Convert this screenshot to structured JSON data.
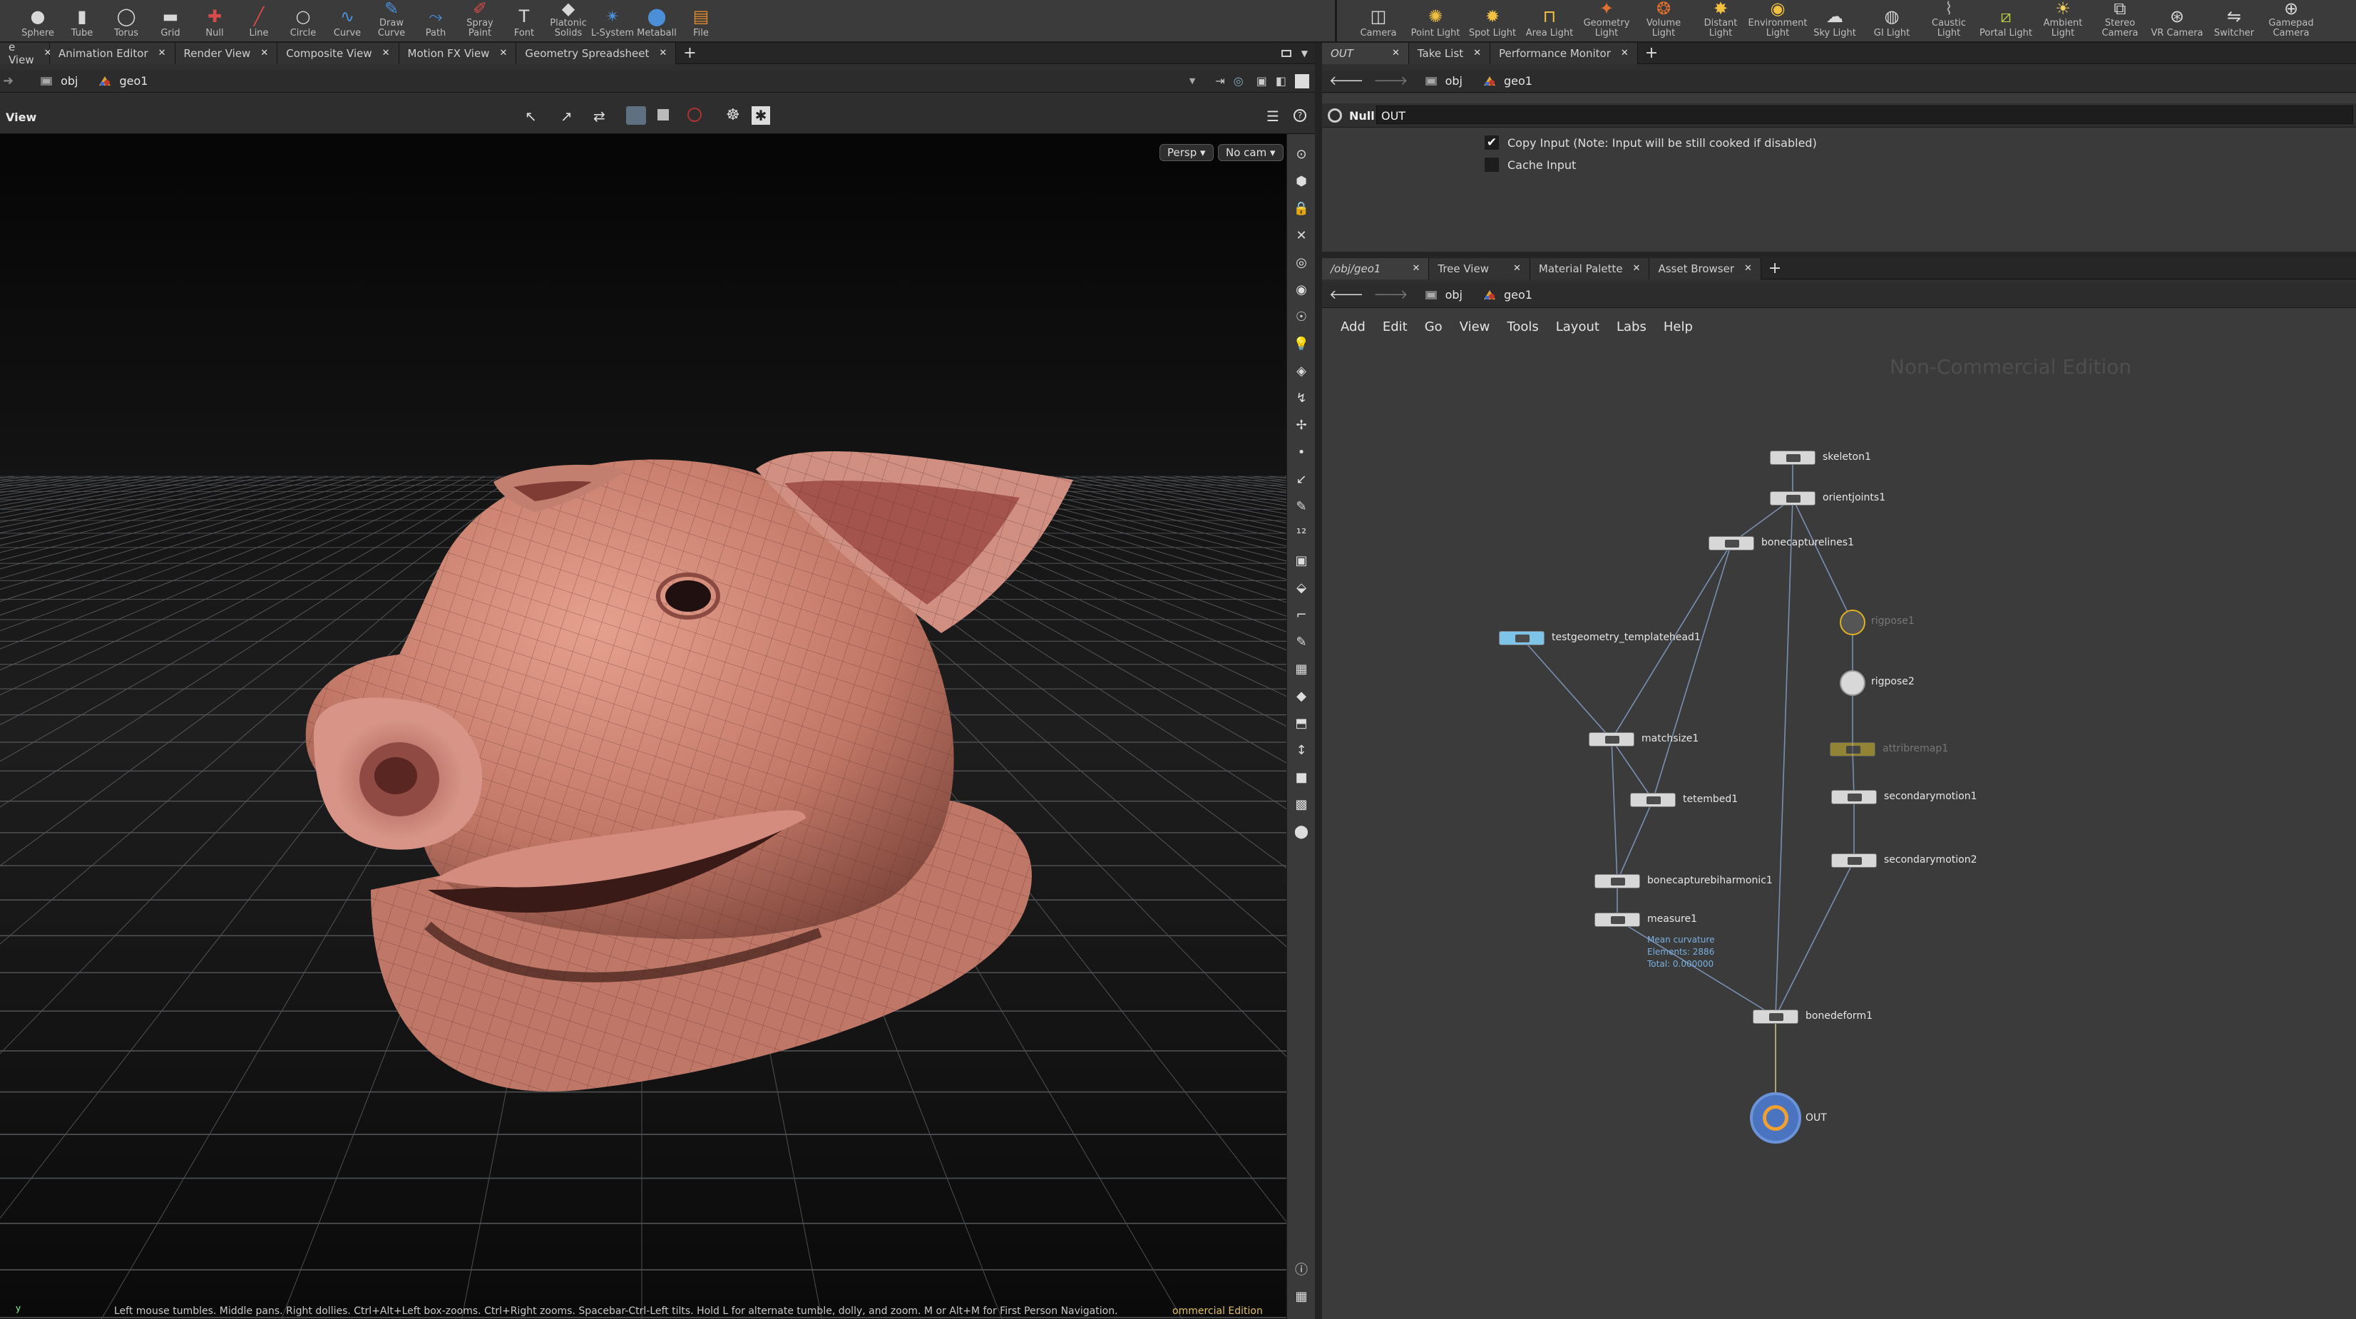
{
  "left_shelf": {
    "tools": [
      {
        "label": "Sphere",
        "icon": "sphere-icon"
      },
      {
        "label": "Tube",
        "icon": "tube-icon"
      },
      {
        "label": "Torus",
        "icon": "torus-icon"
      },
      {
        "label": "Grid",
        "icon": "grid-icon"
      },
      {
        "label": "Null",
        "icon": "null-icon"
      },
      {
        "label": "Line",
        "icon": "line-icon"
      },
      {
        "label": "Circle",
        "icon": "circle-icon"
      },
      {
        "label": "Curve",
        "icon": "curve-icon"
      },
      {
        "label": "Draw Curve",
        "icon": "draw-curve-icon"
      },
      {
        "label": "Path",
        "icon": "path-icon"
      },
      {
        "label": "Spray Paint",
        "icon": "spray-paint-icon"
      },
      {
        "label": "Font",
        "icon": "font-icon"
      },
      {
        "label": "Platonic Solids",
        "icon": "platonic-solids-icon"
      },
      {
        "label": "L-System",
        "icon": "l-system-icon"
      },
      {
        "label": "Metaball",
        "icon": "metaball-icon"
      },
      {
        "label": "File",
        "icon": "file-icon"
      }
    ]
  },
  "right_shelf": {
    "tools": [
      {
        "label": "Camera",
        "icon": "camera-icon"
      },
      {
        "label": "Point Light",
        "icon": "point-light-icon"
      },
      {
        "label": "Spot Light",
        "icon": "spot-light-icon"
      },
      {
        "label": "Area Light",
        "icon": "area-light-icon"
      },
      {
        "label": "Geometry Light",
        "icon": "geometry-light-icon"
      },
      {
        "label": "Volume Light",
        "icon": "volume-light-icon"
      },
      {
        "label": "Distant Light",
        "icon": "distant-light-icon"
      },
      {
        "label": "Environment Light",
        "icon": "environment-light-icon"
      },
      {
        "label": "Sky Light",
        "icon": "sky-light-icon"
      },
      {
        "label": "GI Light",
        "icon": "gi-light-icon"
      },
      {
        "label": "Caustic Light",
        "icon": "caustic-light-icon"
      },
      {
        "label": "Portal Light",
        "icon": "portal-light-icon"
      },
      {
        "label": "Ambient Light",
        "icon": "ambient-light-icon"
      },
      {
        "label": "Stereo Camera",
        "icon": "stereo-camera-icon"
      },
      {
        "label": "VR Camera",
        "icon": "vr-camera-icon"
      },
      {
        "label": "Switcher",
        "icon": "switcher-icon"
      },
      {
        "label": "Gamepad Camera",
        "icon": "gamepad-camera-icon"
      }
    ]
  },
  "left_tabs": [
    "e View",
    "Animation Editor",
    "Render View",
    "Composite View",
    "Motion FX View",
    "Geometry Spreadsheet"
  ],
  "right_top_tabs": [
    "OUT",
    "Take List",
    "Performance Monitor"
  ],
  "right_bottom_tabs": [
    "/obj/geo1",
    "Tree View",
    "Material Palette",
    "Asset Browser"
  ],
  "path": {
    "obj": "obj",
    "geo": "geo1"
  },
  "viewer": {
    "title": "View",
    "persp": "Persp ▾",
    "cam": "No cam ▾",
    "status": "Left mouse tumbles. Middle pans. Right dollies. Ctrl+Alt+Left box-zooms. Ctrl+Right zooms. Spacebar-Ctrl-Left tilts. Hold L for alternate tumble, dolly, and zoom.    M or Alt+M for First Person Navigation.",
    "edition_tag": "ommercial Edition"
  },
  "params": {
    "node_type": "Null",
    "node_name": "OUT",
    "copy_input_label": "Copy Input (Note: Input will be still cooked if disabled)",
    "copy_input_checked": true,
    "cache_input_label": "Cache Input",
    "cache_input_checked": false
  },
  "network": {
    "menu": [
      "Add",
      "Edit",
      "Go",
      "View",
      "Tools",
      "Layout",
      "Labs",
      "Help"
    ],
    "watermark": "Non-Commercial Edition",
    "nodes": [
      {
        "name": "skeleton1"
      },
      {
        "name": "orientjoints1"
      },
      {
        "name": "bonecapturelines1"
      },
      {
        "name": "testgeometry_templatehead1"
      },
      {
        "name": "rigpose1"
      },
      {
        "name": "rigpose2"
      },
      {
        "name": "attribremap1"
      },
      {
        "name": "matchsize1"
      },
      {
        "name": "tetembed1"
      },
      {
        "name": "secondarymotion1"
      },
      {
        "name": "secondarymotion2"
      },
      {
        "name": "bonecapturebiharmonic1"
      },
      {
        "name": "measure1"
      },
      {
        "name": "bonedeform1"
      },
      {
        "name": "OUT"
      }
    ],
    "measure_info": [
      "Mean curvature",
      "Elements: 2886",
      "Total: 0.000000"
    ]
  }
}
